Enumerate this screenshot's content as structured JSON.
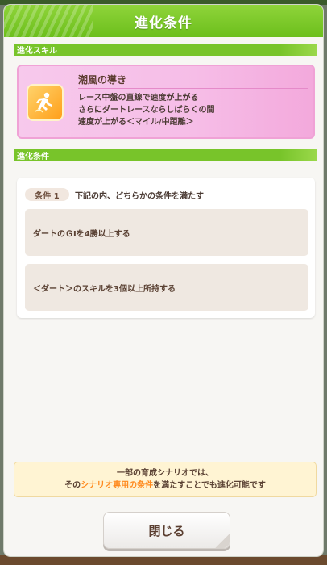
{
  "dialog": {
    "title": "進化条件",
    "section_skill_label": "進化スキル",
    "section_condition_label": "進化条件"
  },
  "skill": {
    "name": "潮風の導き",
    "description": "レース中盤の直線で速度が上がる\nさらにダートレースならしばらくの間\n速度が上がる＜マイル/中距離＞",
    "icon": "running-figure-icon"
  },
  "condition": {
    "tag": "条件 1",
    "heading": "下記の内、どちらかの条件を満たす",
    "items": [
      "ダートのＧⅠを4勝以上する",
      "＜ダート＞のスキルを3個以上所持する"
    ]
  },
  "note": {
    "line1": "一部の育成シナリオでは、",
    "line2_prefix": "その",
    "line2_highlight": "シナリオ専用の条件",
    "line2_suffix": "を満たすことでも進化可能です"
  },
  "buttons": {
    "close_label": "閉じる"
  },
  "colors": {
    "header_green": "#6cbf1c",
    "skill_pink": "#f6bde7",
    "note_highlight": "#ff8a1e"
  }
}
